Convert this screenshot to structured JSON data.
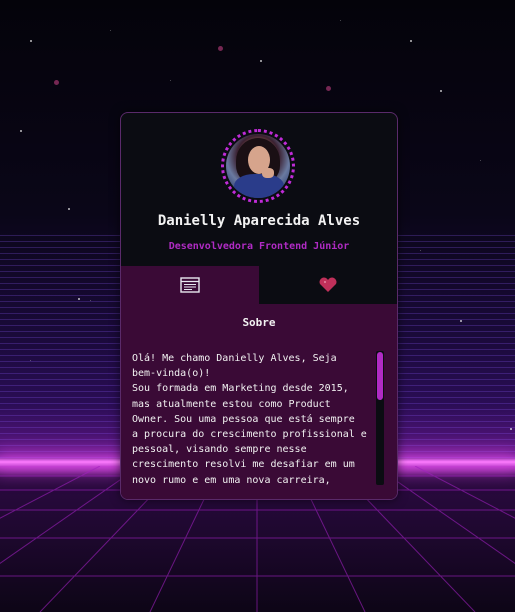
{
  "profile": {
    "name": "Danielly Aparecida Alves",
    "role": "Desenvolvedora Frontend Júnior"
  },
  "tabs": [
    {
      "icon": "browser-window-icon",
      "active": true
    },
    {
      "icon": "heart-icon",
      "active": false
    }
  ],
  "about": {
    "title": "Sobre",
    "text": "Olá! Me chamo Danielly Alves, Seja\nbem-vinda(o)!\nSou formada em Marketing desde 2015,\nmas atualmente estou como Product\nOwner. Sou uma pessoa que está sempre\na procura do crescimento profissional e\npessoal, visando sempre nesse\ncrescimento resolvi me desafiar em um\nnovo rumo e em uma nova carreira,"
  },
  "colors": {
    "accent": "#b02bc4",
    "panel": "#3a0a36",
    "card": "#0b0c12"
  },
  "scroll": {
    "position_fraction": 0.0
  }
}
